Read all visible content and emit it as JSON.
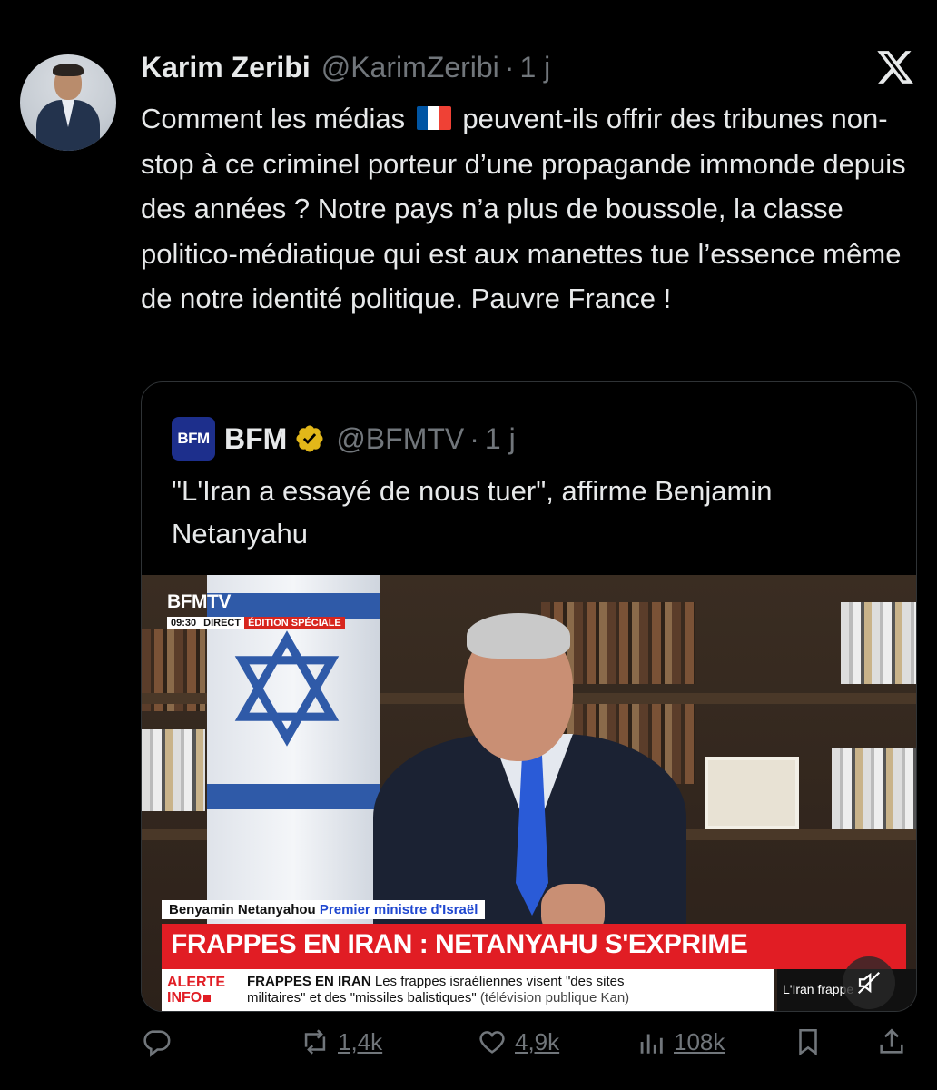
{
  "tweet": {
    "author_name": "Karim Zeribi",
    "author_handle": "@KarimZeribi",
    "separator": "·",
    "time": "1 j",
    "text_before_flag": "Comment les médias",
    "flag_icon": "france-flag-icon",
    "text_after_flag": "peuvent-ils offrir des tribunes non-stop à ce criminel porteur d’une propagande immonde depuis des années ? Notre pays n’a plus de boussole, la classe politico-médiatique qui est aux manettes tue l’essence même de notre identité politique. Pauvre France !"
  },
  "quote": {
    "logo_text": "BFM",
    "author_name": "BFM",
    "author_handle": "@BFMTV",
    "separator": "·",
    "time": "1 j",
    "text": "\"L'Iran a essayé de nous tuer\", affirme Benjamin Netanyahu",
    "video": {
      "channel": "BFMTV",
      "time": "09:30",
      "live": "DIRECT",
      "edition": "ÉDITION SPÉCIALE",
      "name": "Benyamin Netanyahou",
      "role": "Premier ministre d'Israël",
      "headline": "FRAPPES EN IRAN : NETANYAHU S'EXPRIME",
      "alert_line1": "ALERTE",
      "alert_line2": "INFO",
      "ticker_bold": "FRAPPES EN IRAN",
      "ticker_text1": "Les frappes israéliennes visent \"des sites",
      "ticker_text2": "militaires\" et des \"missiles balistiques\"",
      "ticker_paren": "(télévision publique Kan)",
      "ticker_right": "L'Iran frappe"
    }
  },
  "actions": {
    "replies": "",
    "reposts": "1,4k",
    "likes": "4,9k",
    "views": "108k"
  },
  "colors": {
    "background": "#000000",
    "text": "#e7e9ea",
    "muted": "#71767b",
    "border": "#2f3336",
    "verified": "#e2b719",
    "bfm_blue": "#1d2f8c",
    "headline_red": "#e11d24"
  }
}
